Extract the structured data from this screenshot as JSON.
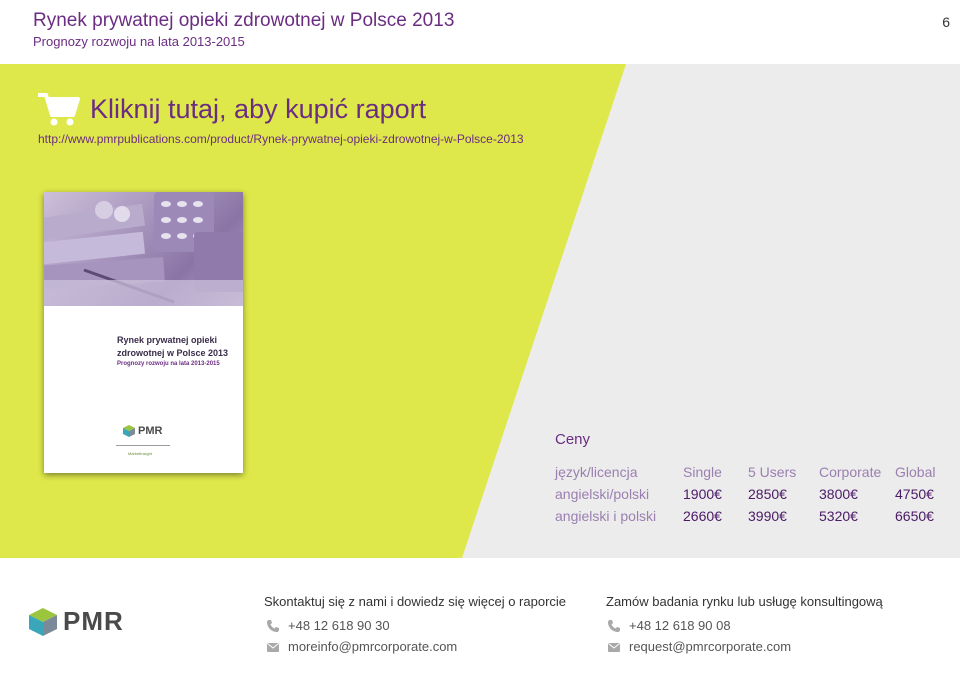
{
  "header": {
    "title": "Rynek prywatnej opieki zdrowotnej w Polsce 2013",
    "subtitle": "Prognozy rozwoju na lata 2013-2015",
    "page_number": "6"
  },
  "colors": {
    "accent_purple": "#6b2d82",
    "lime": "#dfe84a",
    "band_gray": "#ececec"
  },
  "buy": {
    "label": "Kliknij tutaj, aby kupić raport",
    "url": "http://www.pmrpublications.com/product/Rynek-prywatnej-opieki-zdrowotnej-w-Polsce-2013",
    "icon": "shopping-cart-icon"
  },
  "cover": {
    "title": "Rynek prywatnej opieki zdrowotnej w Polsce 2013",
    "subtitle": "Prognozy rozwoju na lata 2013-2015",
    "logo_text": "PMR",
    "partner_text": "MarketInsight"
  },
  "prices": {
    "title": "Ceny",
    "columns": [
      "język/licencja",
      "Single",
      "5 Users",
      "Corporate",
      "Global"
    ],
    "rows": [
      [
        "angielski/polski",
        "1900€",
        "2850€",
        "3800€",
        "4750€"
      ],
      [
        "angielski i polski",
        "2660€",
        "3990€",
        "5320€",
        "6650€"
      ]
    ]
  },
  "footer": {
    "logo_text": "PMR",
    "left": {
      "heading": "Skontaktuj się z nami i dowiedz się więcej o raporcie",
      "phone": "+48 12 618 90 30",
      "email": "moreinfo@pmrcorporate.com"
    },
    "right": {
      "heading": "Zamów badania rynku lub usługę konsultingową",
      "phone": "+48 12 618 90 08",
      "email": "request@pmrcorporate.com"
    }
  }
}
